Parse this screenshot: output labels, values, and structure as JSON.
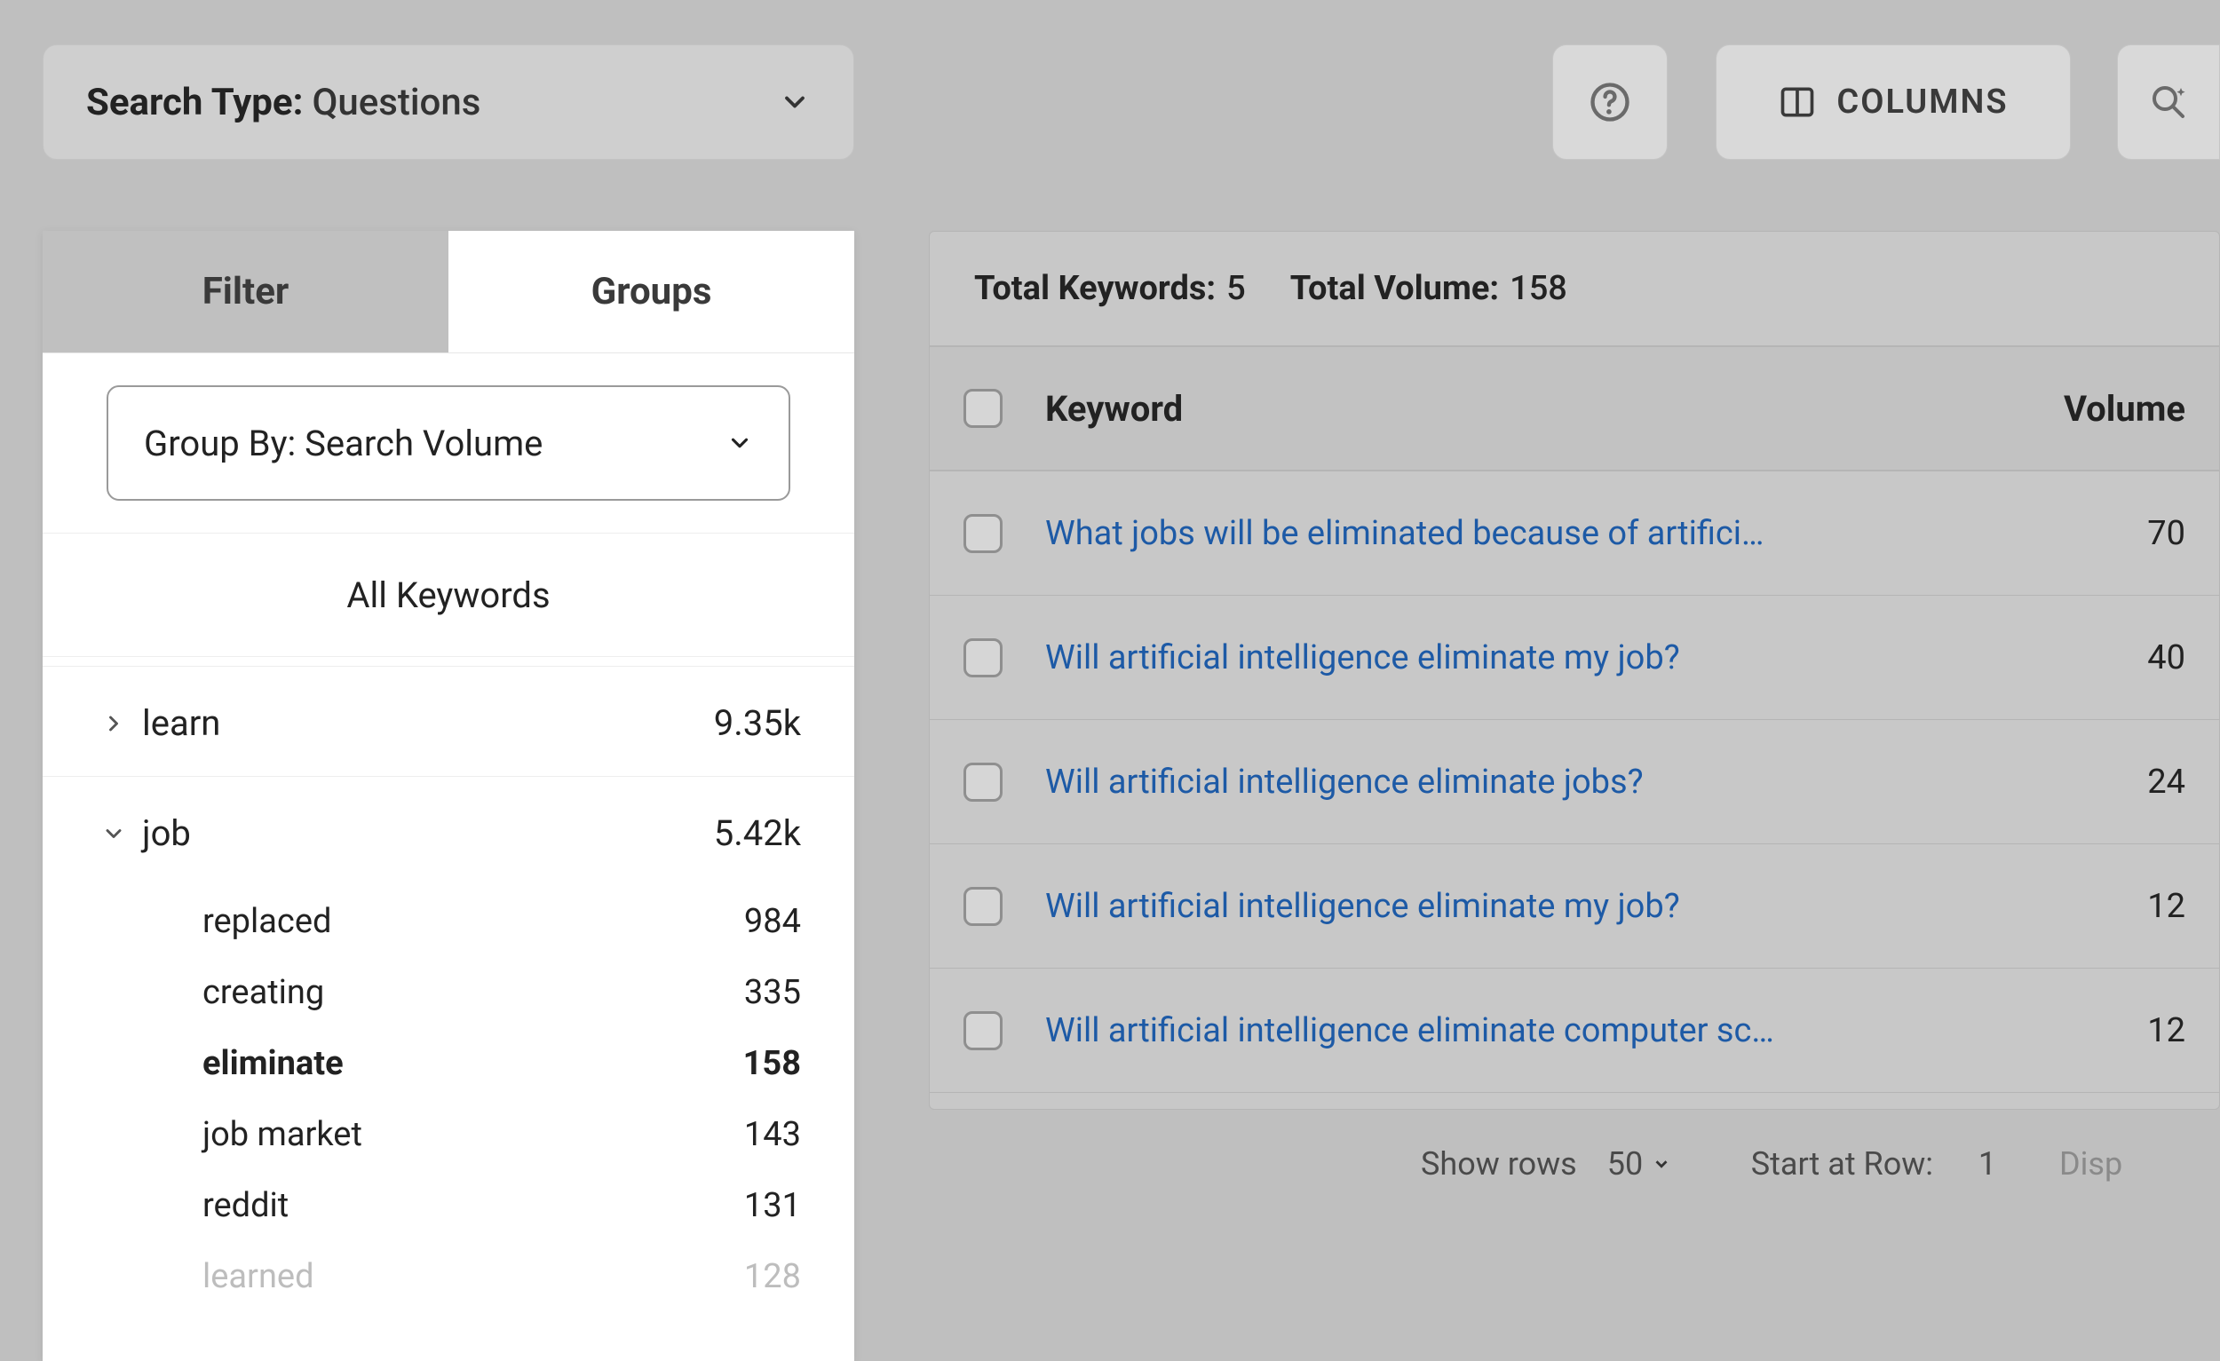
{
  "toolbar": {
    "search_type_label": "Search Type:",
    "search_type_value": "Questions",
    "columns_label": "COLUMNS"
  },
  "left": {
    "tabs": {
      "filter": "Filter",
      "groups": "Groups"
    },
    "group_by_label": "Group By: Search Volume",
    "all_keywords": "All Keywords",
    "groups": [
      {
        "label": "learn",
        "count": "9.35k",
        "expanded": false
      },
      {
        "label": "job",
        "count": "5.42k",
        "expanded": true,
        "children": [
          {
            "label": "replaced",
            "count": "984"
          },
          {
            "label": "creating",
            "count": "335"
          },
          {
            "label": "eliminate",
            "count": "158",
            "selected": true
          },
          {
            "label": "job market",
            "count": "143"
          },
          {
            "label": "reddit",
            "count": "131"
          },
          {
            "label": "learned",
            "count": "128",
            "faded": true
          }
        ]
      }
    ]
  },
  "table": {
    "totals": {
      "keywords_label": "Total Keywords:",
      "keywords_value": "5",
      "volume_label": "Total Volume:",
      "volume_value": "158"
    },
    "headers": {
      "keyword": "Keyword",
      "volume": "Volume"
    },
    "rows": [
      {
        "keyword": "What jobs will be eliminated because of artifici…",
        "volume": "70"
      },
      {
        "keyword": "Will artificial intelligence eliminate my job?",
        "volume": "40"
      },
      {
        "keyword": "Will artificial intelligence eliminate jobs?",
        "volume": "24"
      },
      {
        "keyword": "Will artificial intelligence eliminate my job?",
        "volume": "12"
      },
      {
        "keyword": "Will artificial intelligence eliminate computer sc…",
        "volume": "12"
      }
    ],
    "pager": {
      "show_rows_label": "Show rows",
      "show_rows_value": "50",
      "start_label": "Start at Row:",
      "start_value": "1",
      "disp_label": "Disp"
    }
  }
}
